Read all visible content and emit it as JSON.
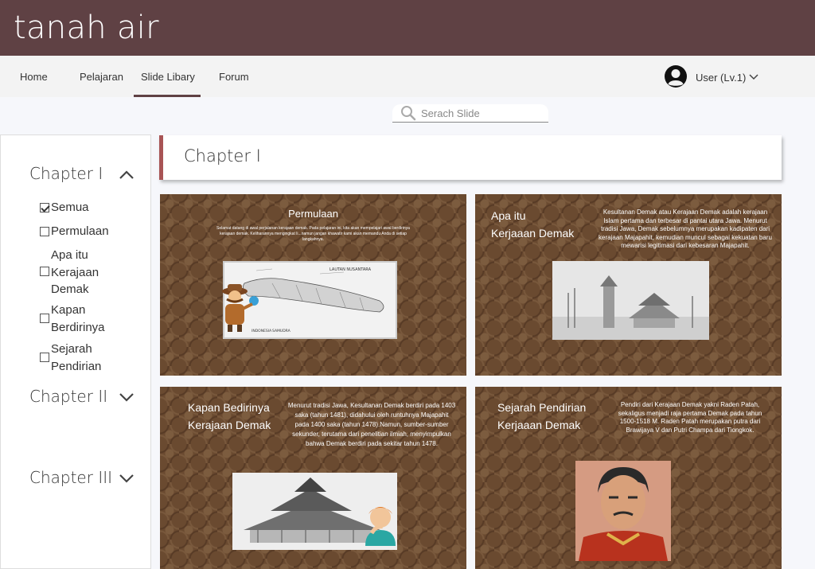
{
  "app": {
    "title": "tanah air"
  },
  "nav": {
    "items": [
      {
        "label": "Home"
      },
      {
        "label": "Pelajaran"
      },
      {
        "label": "Slide Libary"
      },
      {
        "label": "Forum"
      }
    ],
    "active": "Slide Libary",
    "user_label": "User (Lv.1)"
  },
  "search": {
    "placeholder": "Serach Slide"
  },
  "sidebar": {
    "chapters": [
      {
        "title": "Chapter I",
        "expanded": true,
        "items": [
          {
            "label": "Semua",
            "checked": true
          },
          {
            "label": "Permulaan",
            "checked": false
          },
          {
            "label": "Apa itu Kerajaan Demak",
            "checked": false
          },
          {
            "label": "Kapan Berdirinya",
            "checked": false
          },
          {
            "label": "Sejarah Pendirian",
            "checked": false
          }
        ]
      },
      {
        "title": "Chapter II",
        "expanded": false
      },
      {
        "title": "Chapter III",
        "expanded": false
      }
    ]
  },
  "main": {
    "title": "Chapter I",
    "slides": [
      {
        "title": "Permulaan",
        "body": "Selamat datang di awal perjalanan kerajaan demak. Pada pelajaran ini, kita akan mempelajari awal berdirinya kerajaan demak. Keliharannya mengingkat li...namun jangan khawatir kami akan memandu Anda di setiap langkahnya.",
        "image": "map-of-java",
        "map_labels": [
          "LAUTAN NUSANTARA",
          "INDONESIA",
          "SAMUDRA"
        ]
      },
      {
        "title_lines": [
          "Apa itu",
          "Kerjaaan Demak"
        ],
        "body": "Kesultanan Demak atau Kerajaan Demak adalah kerajaan Islam pertama dan terbesar di pantai utara Jawa. Menurut tradisi Jawa, Demak sebelumnya merupakan kadipaten dari kerajaan Majapahit, kemudian muncul sebagai kekuatan baru mewarisi legitimasi dari kebesaran Majapahit.",
        "image": "demak-mosque-sketch"
      },
      {
        "title_lines": [
          "Kapan Bedirinya",
          "Kerajaan Demak"
        ],
        "body": "Menurut tradisi Jawa, Kesultanan Demak berdiri pada 1403 saka (tahun 1481), didahului oleh runtuhnya Majapahit pada 1400 saka (tahun 1478).Namun, sumber-sumber sekunder, terutama dari penelitian ilmiah, menyimpulkan bahwa Demak berdiri pada sekitar tahun 1478.",
        "image": "mosque-roof-sketch"
      },
      {
        "title_lines": [
          "Sejarah Pendirian",
          "Kerjaaan Demak"
        ],
        "body": "Pendiri dari Kerajaan Demak yakni Raden Patah, sekaligus menjadi raja pertama Demak pada tahun 1500-1518 M. Raden Patah merupakan putra dari Brawijaya V dan Putri Champa dari Tiongkok.",
        "image": "raden-patah-portrait"
      }
    ]
  },
  "colors": {
    "topbar": "#5f4144",
    "accent": "#a85455",
    "slide_bg": "#6a4a30"
  },
  "icons": [
    "user-avatar-icon",
    "chevron-down-icon",
    "chevron-up-icon",
    "search-icon",
    "checkbox-icon"
  ]
}
